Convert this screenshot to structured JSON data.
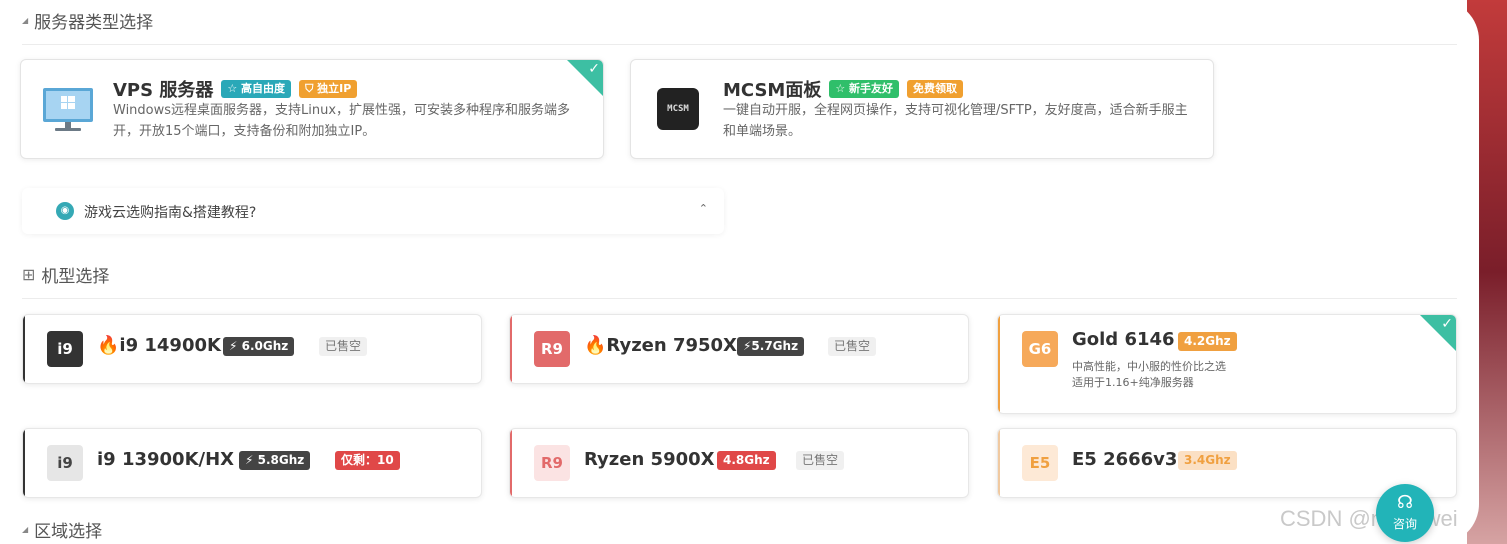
{
  "sections": {
    "server_type": "服务器类型选择",
    "cpu_model": "机型选择",
    "region": "区域选择"
  },
  "services": [
    {
      "title": "VPS 服务器",
      "tags": [
        {
          "label": "☆ 高自由度",
          "color": "#2aa8b8"
        },
        {
          "label": "⛉ 独立IP",
          "color": "#f0a030"
        }
      ],
      "desc": "Windows远程桌面服务器，支持Linux，扩展性强，可安装多种程序和服务端多开，开放15个端口，支持备份和附加独立IP。",
      "selected": true,
      "icon": "windows-monitor-icon"
    },
    {
      "title": "MCSM面板",
      "tags": [
        {
          "label": "☆ 新手友好",
          "color": "#2fbf6a"
        },
        {
          "label": "免费领取",
          "color": "#f0a030"
        }
      ],
      "desc": "一键自动开服，全程网页操作，支持可视化管理/SFTP，友好度高，适合新手服主和单端场景。",
      "selected": false,
      "icon": "mcsm-logo-icon"
    }
  ],
  "guide": {
    "text": "游戏云选购指南&搭建教程?",
    "arrow": "⌃"
  },
  "cpus": [
    {
      "badge": "i9",
      "name": "🔥i9 14900K",
      "speed": "⚡ 6.0Ghz",
      "speed_color": "#444444",
      "status": "已售空",
      "status_type": "soldout",
      "badge_bg": "#333333",
      "badge_fg": "#ffffff",
      "bar": "#333333"
    },
    {
      "badge": "R9",
      "name": "🔥Ryzen 7950X",
      "speed": "⚡5.7Ghz",
      "speed_color": "#444444",
      "status": "已售空",
      "status_type": "soldout",
      "badge_bg": "#e26a6a",
      "badge_fg": "#ffffff",
      "bar": "#e26a6a"
    },
    {
      "badge": "G6",
      "name": "Gold 6146",
      "speed": "4.2Ghz",
      "speed_color": "#f0a040",
      "status": "",
      "status_type": "none",
      "badge_bg": "#f6a95a",
      "badge_fg": "#ffffff",
      "bar": "#f0a040",
      "desc1": "中高性能，中小服的性价比之选",
      "desc2": "适用于1.16+纯净服务器",
      "selected": true
    },
    {
      "badge": "i9",
      "name": "i9 13900K/HX",
      "speed": "⚡ 5.8Ghz",
      "speed_color": "#444444",
      "status": "仅剩：10",
      "status_type": "remain",
      "badge_bg": "#e6e6e6",
      "badge_fg": "#444444",
      "bar": "#333333"
    },
    {
      "badge": "R9",
      "name": "Ryzen 5900X",
      "speed": "4.8Ghz",
      "speed_color": "#e04848",
      "status": "已售空",
      "status_type": "soldout",
      "badge_bg": "#fbe3e3",
      "badge_fg": "#e26a6a",
      "bar": "#e26a6a"
    },
    {
      "badge": "E5",
      "name": "E5 2666v3",
      "speed": "3.4Ghz",
      "speed_color": "#fbe0c4",
      "speed_fg": "#f0a040",
      "status": "",
      "status_type": "none",
      "badge_bg": "#fde9d6",
      "badge_fg": "#f0a040",
      "bar": "#f0c9a0"
    }
  ],
  "fab": {
    "label": "咨询",
    "icon": "headset-icon"
  },
  "watermark": "CSDN @muzewei",
  "colors": {
    "accent": "#3dbfa3",
    "teal": "#22b4b8"
  }
}
